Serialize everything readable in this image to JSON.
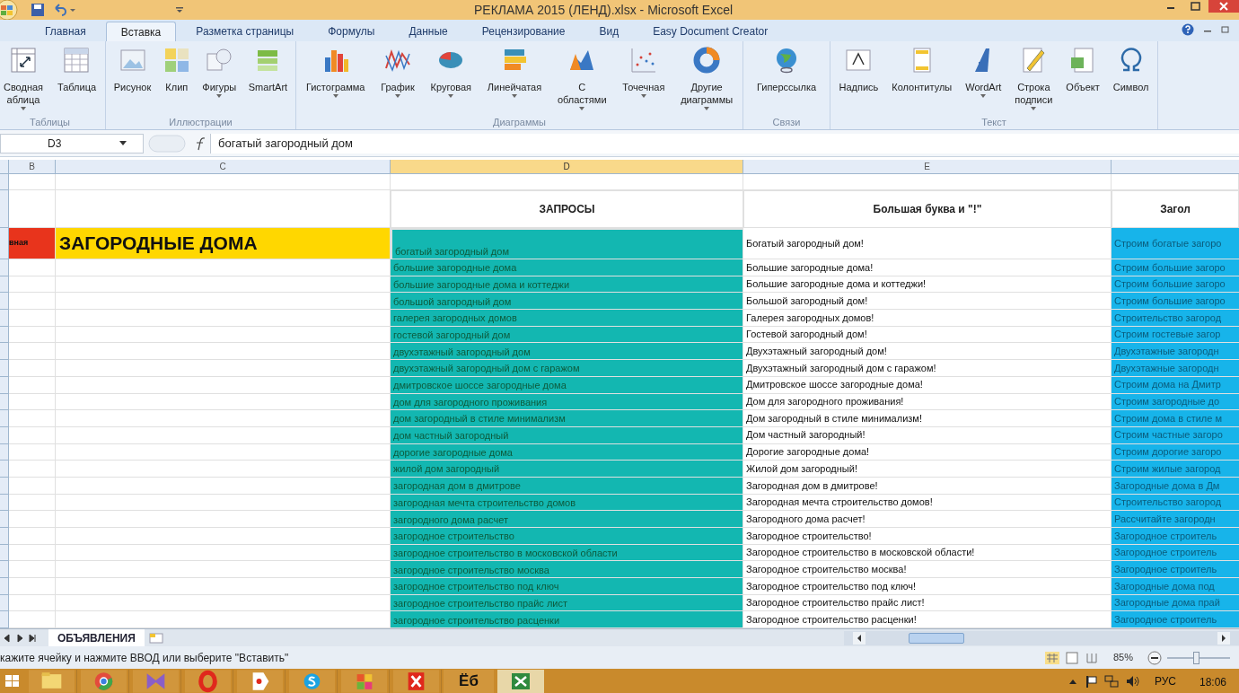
{
  "window": {
    "title": "РЕКЛАМА 2015 (ЛЕНД).xlsx - Microsoft Excel"
  },
  "ribbon": {
    "tabs": [
      {
        "label": "Главная",
        "selected": false
      },
      {
        "label": "Вставка",
        "selected": true
      },
      {
        "label": "Разметка страницы",
        "selected": false
      },
      {
        "label": "Формулы",
        "selected": false
      },
      {
        "label": "Данные",
        "selected": false
      },
      {
        "label": "Рецензирование",
        "selected": false
      },
      {
        "label": "Вид",
        "selected": false
      },
      {
        "label": "Easy Document Creator",
        "selected": false
      }
    ],
    "groups": [
      {
        "label": "Таблицы",
        "buttons": [
          {
            "label": "Сводная аблица",
            "menu": true
          },
          {
            "label": "Таблица",
            "menu": false
          }
        ]
      },
      {
        "label": "Иллюстрации",
        "buttons": [
          {
            "label": "Рисунок",
            "menu": false
          },
          {
            "label": "Клип",
            "menu": false
          },
          {
            "label": "Фигуры",
            "menu": true
          },
          {
            "label": "SmartArt",
            "menu": false
          }
        ]
      },
      {
        "label": "Диаграммы",
        "buttons": [
          {
            "label": "Гистограмма",
            "menu": true
          },
          {
            "label": "График",
            "menu": true
          },
          {
            "label": "Круговая",
            "menu": true
          },
          {
            "label": "Линейчатая",
            "menu": true
          },
          {
            "label": "С областями",
            "menu": true
          },
          {
            "label": "Точечная",
            "menu": true
          },
          {
            "label": "Другие диаграммы",
            "menu": true
          }
        ]
      },
      {
        "label": "Связи",
        "buttons": [
          {
            "label": "Гиперссылка",
            "menu": false
          }
        ]
      },
      {
        "label": "Текст",
        "buttons": [
          {
            "label": "Надпись",
            "menu": false
          },
          {
            "label": "Колонтитулы",
            "menu": false
          },
          {
            "label": "WordArt",
            "menu": true
          },
          {
            "label": "Строка подписи",
            "menu": true
          },
          {
            "label": "Объект",
            "menu": false
          },
          {
            "label": "Символ",
            "menu": false
          }
        ]
      }
    ]
  },
  "formula_bar": {
    "name_box": "D3",
    "formula": "богатый загородный дом"
  },
  "sheet": {
    "columns": [
      {
        "label": "B",
        "selected": false
      },
      {
        "label": "C",
        "selected": false
      },
      {
        "label": "D",
        "selected": true
      },
      {
        "label": "E",
        "selected": false
      }
    ],
    "headers": [
      "ЗАПРОСЫ",
      "Большая буква и \"!\"",
      "Загол"
    ],
    "title_row": {
      "tag": "вная",
      "title": "ЗАГОРОДНЫЕ ДОМА"
    },
    "rows": [
      {
        "d": "богатый загородный дом",
        "e": "Богатый загородный дом!",
        "f": "Строим богатые загоро",
        "selected": true
      },
      {
        "d": "большие загородные дома",
        "e": "Большие загородные дома!",
        "f": "Строим большие загоро",
        "selected": false
      },
      {
        "d": "большие загородные дома и коттеджи",
        "e": "Большие загородные дома и коттеджи!",
        "f": "Строим большие загоро",
        "selected": false
      },
      {
        "d": "большой загородный дом",
        "e": "Большой загородный дом!",
        "f": "Строим большие загоро",
        "selected": false
      },
      {
        "d": "галерея загородных домов",
        "e": "Галерея загородных домов!",
        "f": "Строительство загород",
        "selected": false
      },
      {
        "d": "гостевой загородный дом",
        "e": "Гостевой загородный дом!",
        "f": "Строим гостевые загор",
        "selected": false
      },
      {
        "d": "двухэтажный загородный дом",
        "e": "Двухэтажный загородный дом!",
        "f": "Двухэтажные загородн",
        "selected": false
      },
      {
        "d": "двухэтажный загородный дом с гаражом",
        "e": "Двухэтажный загородный дом с гаражом!",
        "f": "Двухэтажные загородн",
        "selected": false
      },
      {
        "d": "дмитровское шоссе загородные дома",
        "e": "Дмитровское шоссе загородные дома!",
        "f": "Строим дома на Дмитр",
        "selected": false
      },
      {
        "d": "дом для загородного проживания",
        "e": "Дом для загородного проживания!",
        "f": "Строим загородные до",
        "selected": false
      },
      {
        "d": "дом загородный в стиле минимализм",
        "e": "Дом загородный в стиле минимализм!",
        "f": "Строим дома в стиле м",
        "selected": false
      },
      {
        "d": "дом частный загородный",
        "e": "Дом частный загородный!",
        "f": "Строим частные загоро",
        "selected": false
      },
      {
        "d": "дорогие загородные дома",
        "e": "Дорогие загородные дома!",
        "f": "Строим дорогие загоро",
        "selected": false
      },
      {
        "d": "жилой дом загородный",
        "e": "Жилой дом загородный!",
        "f": "Строим жилые загород",
        "selected": false
      },
      {
        "d": "загородная дом в дмитрове",
        "e": "Загородная дом в дмитрове!",
        "f": "Загородные дома в Дм",
        "selected": false
      },
      {
        "d": "загородная мечта строительство домов",
        "e": "Загородная мечта строительство домов!",
        "f": "Строительство загород",
        "selected": false
      },
      {
        "d": "загородного дома расчет",
        "e": "Загородного дома расчет!",
        "f": "Рассчитайте загородн",
        "selected": false
      },
      {
        "d": "загородное строительство",
        "e": "Загородное строительство!",
        "f": "Загородное строитель",
        "selected": false
      },
      {
        "d": "загородное строительство в московской области",
        "e": "Загородное строительство в московской области!",
        "f": "Загородное строитель",
        "selected": false
      },
      {
        "d": "загородное строительство москва",
        "e": "Загородное строительство москва!",
        "f": "Загородное строитель",
        "selected": false
      },
      {
        "d": "загородное строительство под ключ",
        "e": "Загородное строительство под ключ!",
        "f": "Загородные дома под",
        "selected": false
      },
      {
        "d": "загородное строительство прайс лист",
        "e": "Загородное строительство прайс лист!",
        "f": "Загородные дома прай",
        "selected": false
      },
      {
        "d": "загородное строительство расценки",
        "e": "Загородное строительство расценки!",
        "f": "Загородное строитель",
        "selected": false
      }
    ]
  },
  "sheet_tabs": [
    {
      "label": "ОБЪЯВЛЕНИЯ",
      "selected": true
    }
  ],
  "status_bar": {
    "message": "кажите ячейку и нажмите ВВОД или выберите \"Вставить\"",
    "zoom": "85%",
    "zoom_slider": {
      "level": 0.45
    }
  },
  "taskbar": {
    "app_label": "Ёб",
    "language": "РУС",
    "time": "18:06"
  }
}
